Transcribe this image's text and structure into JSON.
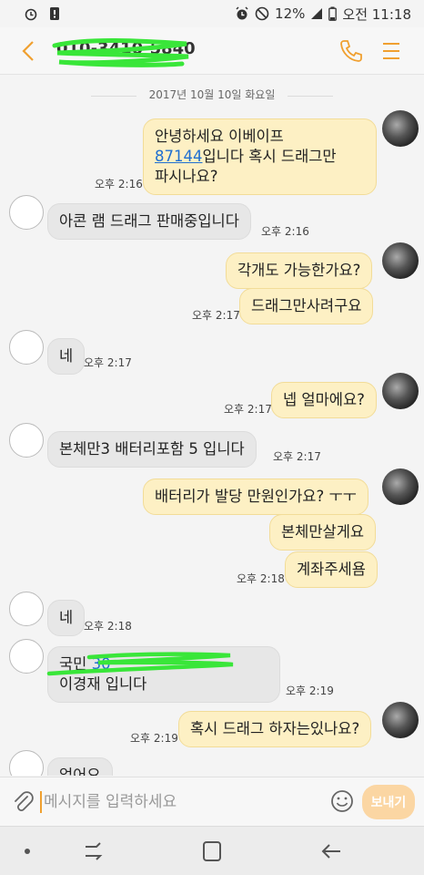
{
  "status_bar": {
    "battery": "12%",
    "time": "오전 11:18",
    "icons": [
      "alarm-icon",
      "download-icon",
      "alarm-clock-icon",
      "do-not-disturb-icon",
      "signal-icon",
      "battery-icon"
    ]
  },
  "header": {
    "contact_name": "010-3410-5840"
  },
  "chat": {
    "date": "2017년 10월 10일 화요일",
    "messages": [
      {
        "dir": "out",
        "lines": [
          "안녕하세요 이베이프",
          "87144입니다 혹시 드래그만",
          "파시나요?"
        ],
        "link": "87144",
        "time": "오후 2:16"
      },
      {
        "dir": "in",
        "text": "아콘 램 드래그 판매중입니다",
        "time": "오후 2:16"
      },
      {
        "dir": "out",
        "text": "각개도 가능한가요?",
        "time": ""
      },
      {
        "dir": "out",
        "text": "드래그만사려구요",
        "time": "오후 2:17"
      },
      {
        "dir": "in",
        "text": "네",
        "time": "오후 2:17"
      },
      {
        "dir": "out",
        "text": "넵 얼마에요?",
        "time": "오후 2:17"
      },
      {
        "dir": "in",
        "text": "본체만3  배터리포함 5  입니다",
        "time": "오후 2:17"
      },
      {
        "dir": "out",
        "text": "배터리가 발당 만원인가요? ㅜㅜ",
        "time": ""
      },
      {
        "dir": "out",
        "text": "본체만살게요",
        "time": ""
      },
      {
        "dir": "out",
        "text": "계좌주세욤",
        "time": "오후 2:18"
      },
      {
        "dir": "in",
        "text": "네",
        "time": "오후 2:18"
      },
      {
        "dir": "in",
        "lines": [
          "국민 30",
          "이경재 입니다"
        ],
        "link": "30",
        "time": "오후 2:19"
      },
      {
        "dir": "out",
        "text": "혹시 드래그 하자는있나요?",
        "time": "오후 2:19"
      },
      {
        "dir": "in",
        "text": "없어요",
        "time": ""
      }
    ]
  },
  "composer": {
    "placeholder": "메시지를 입력하세요",
    "send_label": "보내기"
  },
  "colors": {
    "accent": "#f0a030",
    "outgoing_bubble": "#fdf0c4",
    "incoming_bubble": "#e7e7e7",
    "link": "#1f6fd1",
    "redaction": "#39e639"
  }
}
